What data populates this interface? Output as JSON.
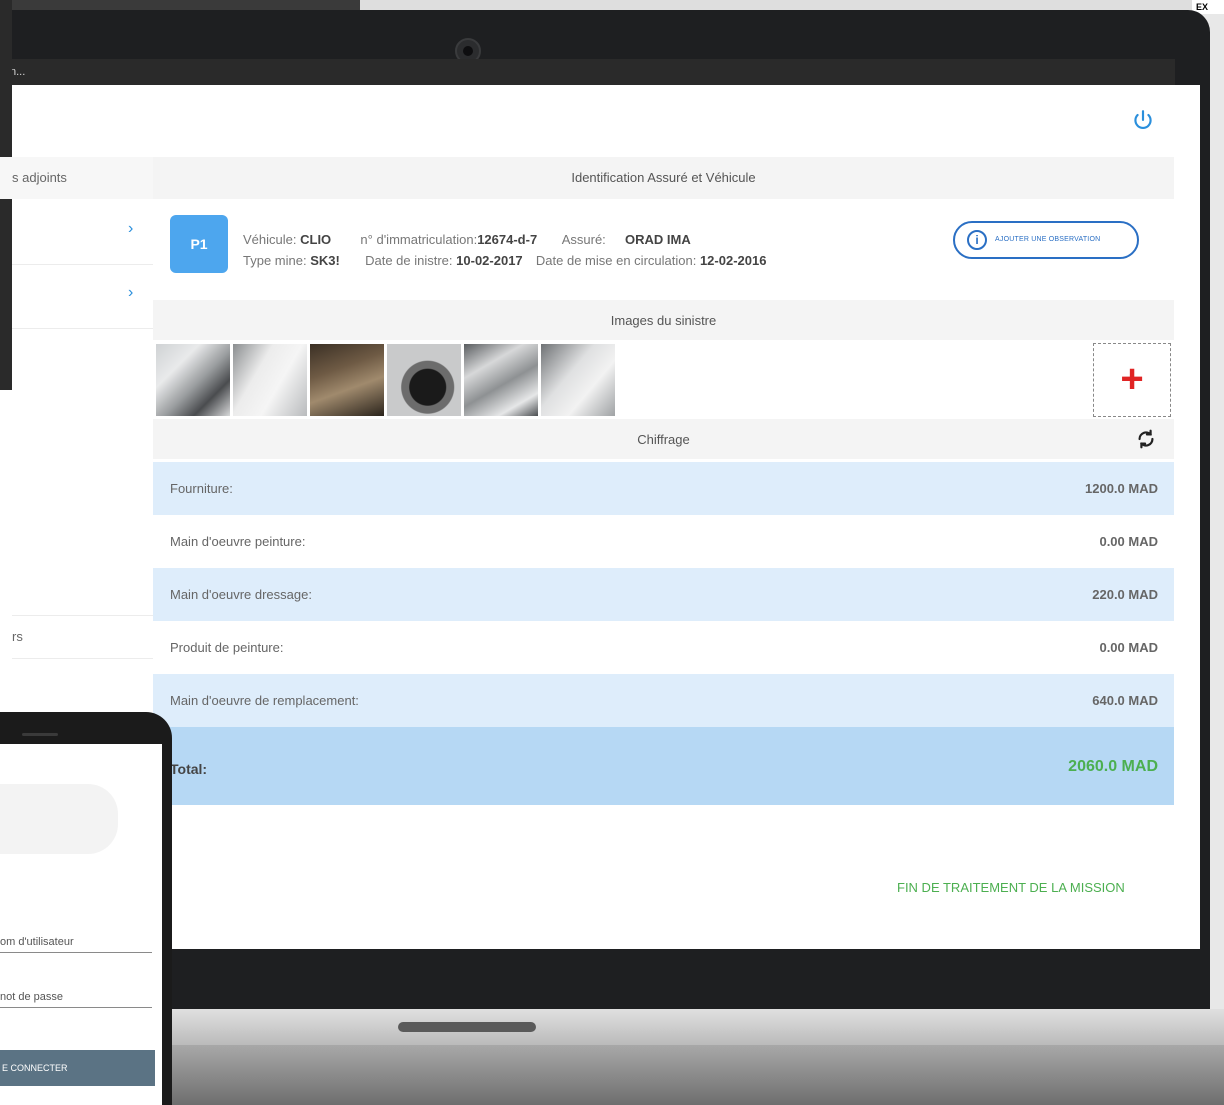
{
  "window": {
    "corner_badge": "EX",
    "statusbar_text": "n..."
  },
  "sidebar": {
    "header_label": "s adjoints",
    "items": [
      {
        "chevron": "›"
      },
      {
        "chevron": "›"
      }
    ],
    "footer_label": "rs"
  },
  "identification": {
    "title": "Identification Assuré et Véhicule",
    "badge": "P1",
    "vehicle_label": "Véhicule:",
    "vehicle_value": "CLIO",
    "immat_label": "n° d'immatriculation:",
    "immat_value": "12674-d-7",
    "assure_label": "Assuré:",
    "assure_value": "ORAD IMA",
    "type_label": "Type mine:",
    "type_value": "SK3!",
    "date_sinistre_label": "Date de inistre:",
    "date_sinistre_value": "10-02-2017",
    "date_circulation_label": "Date de mise en circulation:",
    "date_circulation_value": "12-02-2016",
    "observation_button": "AJOUTER UNE OBSERVATION"
  },
  "images": {
    "title": "Images du sinistre",
    "add_symbol": "+"
  },
  "chiffrage": {
    "title": "Chiffrage",
    "rows": [
      {
        "label": "Fourniture:",
        "value": "1200.0 MAD"
      },
      {
        "label": "Main d'oeuvre peinture:",
        "value": "0.00 MAD"
      },
      {
        "label": "Main d'oeuvre dressage:",
        "value": "220.0 MAD"
      },
      {
        "label": "Produit de peinture:",
        "value": "0.00 MAD"
      },
      {
        "label": "Main d'oeuvre de remplacement:",
        "value": "640.0 MAD"
      }
    ],
    "total_label": "Total:",
    "total_value": "2060.0 MAD"
  },
  "actions": {
    "finish": "FIN DE TRAITEMENT DE LA MISSION"
  },
  "phone": {
    "username_placeholder": "om d'utilisateur",
    "password_placeholder": "not de passe",
    "login_button": "E CONNECTER"
  },
  "colors": {
    "accent": "#2a8fdc",
    "badge": "#4da6ee",
    "row_blue": "#deedfb",
    "total_bg": "#b6d8f4",
    "total_green": "#4caf50",
    "add_red": "#e02424"
  }
}
